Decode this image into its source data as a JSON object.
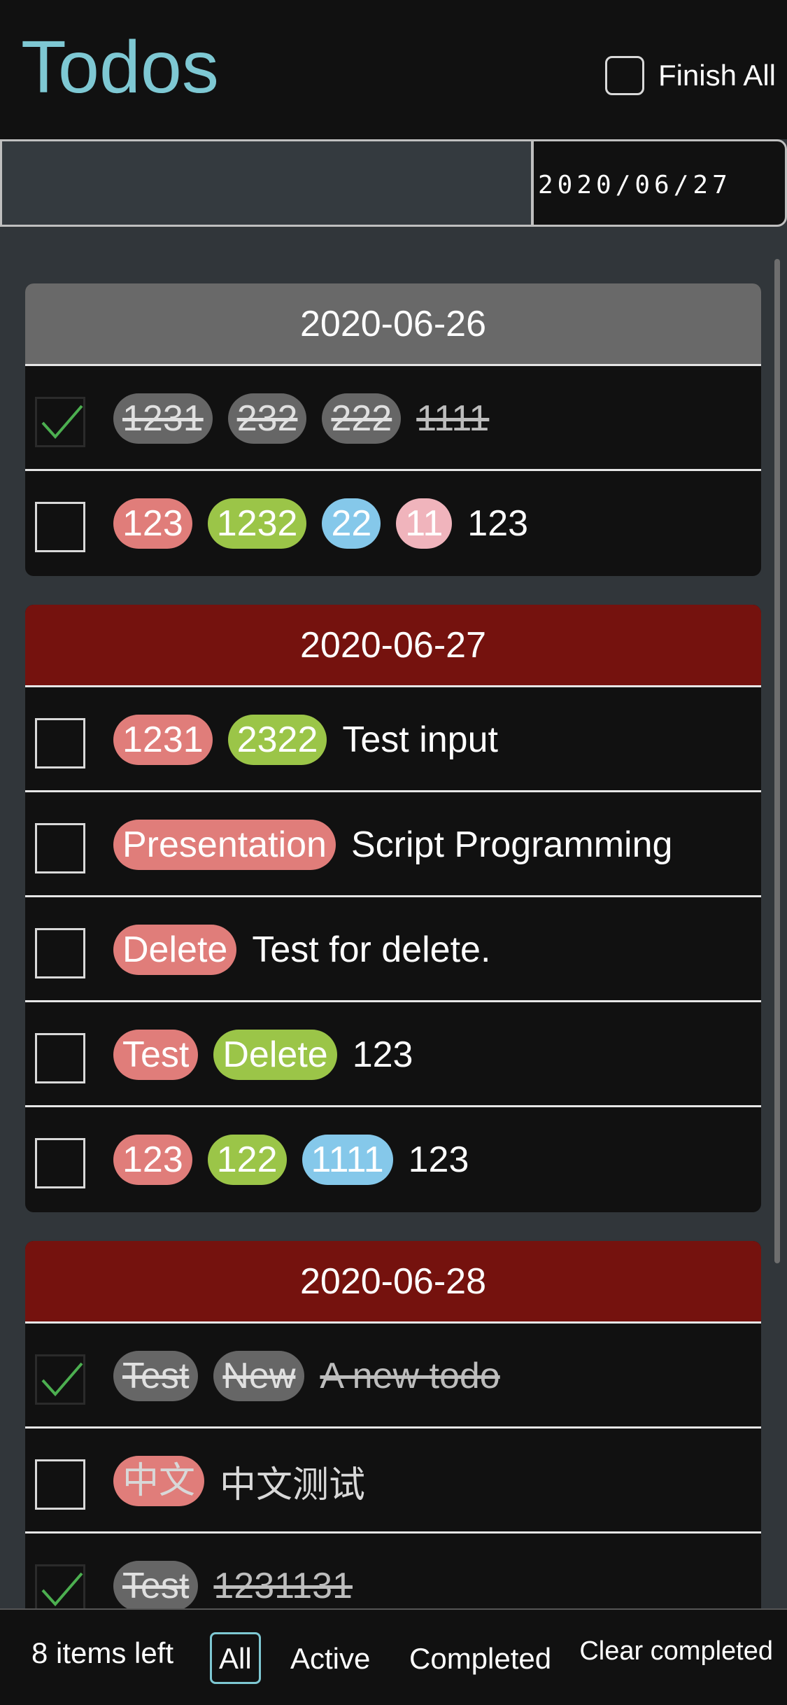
{
  "header": {
    "title": "Todos",
    "finish_all_label": "Finish All"
  },
  "new_todo": {
    "value": "",
    "date_value": "2020/06/27"
  },
  "groups": [
    {
      "date": "2020-06-26",
      "todos": [
        {
          "completed": true,
          "tags": [
            "1231",
            "232",
            "222"
          ],
          "text": "1111"
        },
        {
          "completed": false,
          "tags": [
            "123",
            "1232",
            "22",
            "11"
          ],
          "text": "123"
        }
      ]
    },
    {
      "date": "2020-06-27",
      "todos": [
        {
          "completed": false,
          "tags": [
            "1231",
            "2322"
          ],
          "text": "Test input"
        },
        {
          "completed": false,
          "tags": [
            "Presentation"
          ],
          "text": "Script Programming"
        },
        {
          "completed": false,
          "tags": [
            "Delete"
          ],
          "text": "Test for delete."
        },
        {
          "completed": false,
          "tags": [
            "Test",
            "Delete"
          ],
          "text": "123"
        },
        {
          "completed": false,
          "tags": [
            "123",
            "122",
            "1111"
          ],
          "text": "123"
        }
      ]
    },
    {
      "date": "2020-06-28",
      "todos": [
        {
          "completed": true,
          "tags": [
            "Test",
            "New"
          ],
          "text": "A new todo"
        },
        {
          "completed": false,
          "tags": [
            "中文"
          ],
          "text": "中文测试"
        },
        {
          "completed": true,
          "tags": [
            "Test"
          ],
          "text": "1231131"
        }
      ]
    }
  ],
  "footer": {
    "items_left": "8 items left",
    "filters": [
      "All",
      "Active",
      "Completed"
    ],
    "selected_filter": "All",
    "clear_completed": "Clear completed"
  },
  "colors": {
    "accent": "#7ec8d3",
    "past_header": "#696969",
    "current_header": "#75120e",
    "tag_red": "#e07d7a",
    "tag_green": "#9bc548",
    "tag_blue": "#85c8ea",
    "tag_pink": "#f0b4bc",
    "tag_done": "#666666",
    "check_mark": "#4caf50"
  }
}
